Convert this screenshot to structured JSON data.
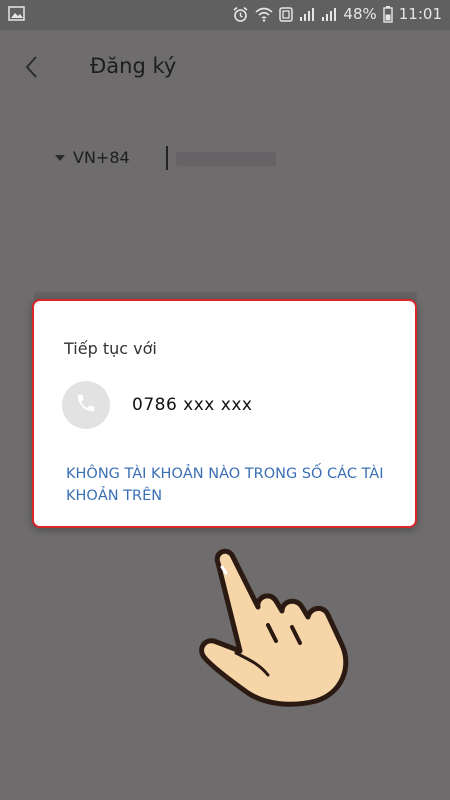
{
  "status_bar": {
    "battery_percent": "48%",
    "time": "11:01",
    "icons": [
      "image-icon",
      "alarm-icon",
      "wifi-icon",
      "nfc-icon",
      "signal-icon",
      "signal-icon",
      "battery-icon"
    ]
  },
  "header": {
    "back_icon": "chevron-left-icon",
    "title": "Đăng ký"
  },
  "phone_form": {
    "country_code": "VN+84"
  },
  "dialog": {
    "title": "Tiếp tục với",
    "account_icon": "phone-icon",
    "account_number": "0786 xxx xxx",
    "none_option": "KHÔNG TÀI KHOẢN NÀO TRONG SỐ CÁC TÀI KHOẢN TRÊN"
  },
  "colors": {
    "overlay": "#6e6c6d",
    "dialog_border": "#d8262b",
    "link": "#3a6fb5",
    "hand_fill": "#f6d5a8",
    "hand_outline": "#2b1a12"
  }
}
